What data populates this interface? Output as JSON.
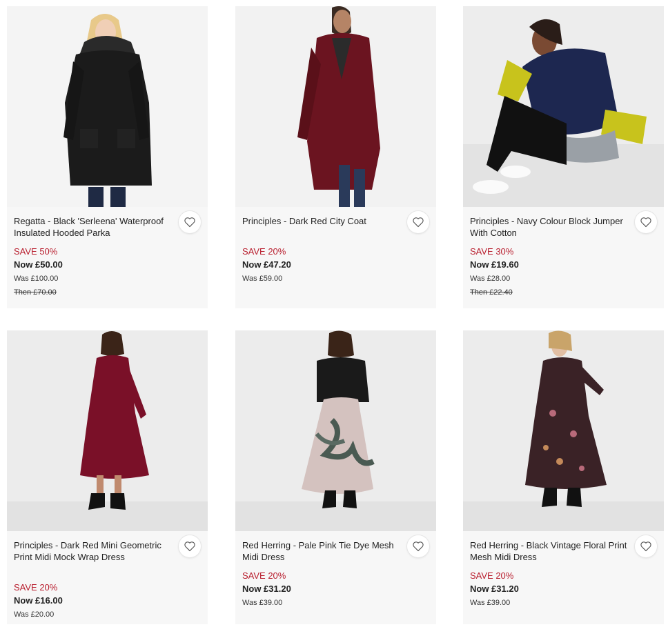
{
  "products": [
    {
      "title": "Regatta - Black 'Serleena' Waterproof Insulated Hooded Parka",
      "save": "SAVE 50%",
      "now": "Now £50.00",
      "was": "Was £100.00",
      "then": "Then £70.00",
      "icon": "heart-icon"
    },
    {
      "title": "Principles - Dark Red City Coat",
      "save": "SAVE 20%",
      "now": "Now £47.20",
      "was": "Was £59.00",
      "icon": "heart-icon"
    },
    {
      "title": "Principles - Navy Colour Block Jumper With Cotton",
      "save": "SAVE 30%",
      "now": "Now £19.60",
      "was": "Was £28.00",
      "then": "Then £22.40",
      "icon": "heart-icon"
    },
    {
      "title": "Principles - Dark Red Mini Geometric Print Midi Mock Wrap Dress",
      "save": "SAVE 20%",
      "now": "Now £16.00",
      "was": "Was £20.00",
      "icon": "heart-icon"
    },
    {
      "title": "Red Herring - Pale Pink Tie Dye Mesh Midi Dress",
      "save": "SAVE 20%",
      "now": "Now £31.20",
      "was": "Was £39.00",
      "icon": "heart-icon"
    },
    {
      "title": "Red Herring - Black Vintage Floral Print Mesh Midi Dress",
      "save": "SAVE 20%",
      "now": "Now £31.20",
      "was": "Was £39.00",
      "icon": "heart-icon"
    }
  ],
  "colors": {
    "sale_red": "#b81c2c",
    "card_bg": "#f7f7f7",
    "image_bg": "#ececec"
  }
}
